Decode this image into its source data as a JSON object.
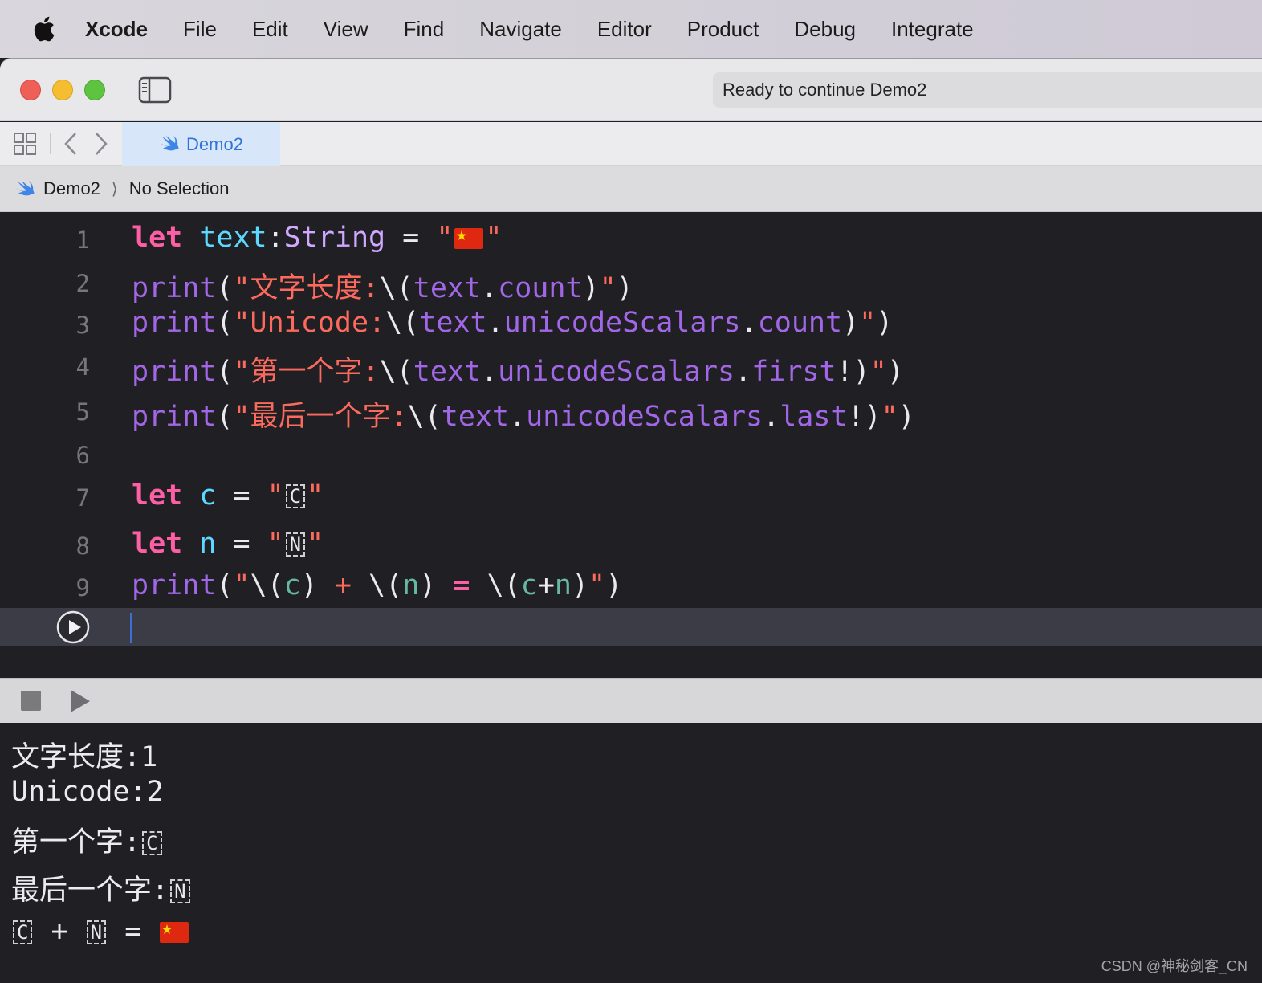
{
  "menubar": {
    "app_name": "Xcode",
    "items": [
      "File",
      "Edit",
      "View",
      "Find",
      "Navigate",
      "Editor",
      "Product",
      "Debug",
      "Integrate"
    ]
  },
  "toolbar": {
    "status_text": "Ready to continue Demo2"
  },
  "tabs": [
    {
      "label": "Demo2",
      "icon": "swift-icon",
      "active": true
    }
  ],
  "jumpbar": {
    "project": "Demo2",
    "selection": "No Selection"
  },
  "editor": {
    "line_numbers": [
      "1",
      "2",
      "3",
      "4",
      "5",
      "6",
      "7",
      "8",
      "9"
    ],
    "lines": {
      "l1": {
        "kw": "let",
        "name": "text",
        "colon": ":",
        "type": "String",
        "eq": " = ",
        "q1": "\"",
        "q2": "\""
      },
      "l2": {
        "fn": "print",
        "p1": "(",
        "str": "\"文字长度:",
        "interp": "\\(",
        "a": "text",
        "dot": ".",
        "b": "count",
        "close": ")",
        "q": "\"",
        "p2": ")"
      },
      "l3": {
        "fn": "print",
        "p1": "(",
        "str": "\"Unicode:",
        "interp": "\\(",
        "a": "text",
        "dot1": ".",
        "b": "unicodeScalars",
        "dot2": ".",
        "c": "count",
        "close": ")",
        "q": "\"",
        "p2": ")"
      },
      "l4": {
        "fn": "print",
        "p1": "(",
        "str": "\"第一个字:",
        "interp": "\\(",
        "a": "text",
        "dot1": ".",
        "b": "unicodeScalars",
        "dot2": ".",
        "c": "first",
        "bang": "!",
        "close": ")",
        "q": "\"",
        "p2": ")"
      },
      "l5": {
        "fn": "print",
        "p1": "(",
        "str": "\"最后一个字:",
        "interp": "\\(",
        "a": "text",
        "dot1": ".",
        "b": "unicodeScalars",
        "dot2": ".",
        "c": "last",
        "bang": "!",
        "close": ")",
        "q": "\"",
        "p2": ")"
      },
      "l7": {
        "kw": "let",
        "name": "c",
        "eq": " = ",
        "q1": "\"",
        "box": "C",
        "q2": "\""
      },
      "l8": {
        "kw": "let",
        "name": "n",
        "eq": " = ",
        "q1": "\"",
        "box": "N",
        "q2": "\""
      },
      "l9": {
        "fn": "print",
        "p1": "(",
        "q1": "\"",
        "i1": "\\(",
        "a": "c",
        "c1": ")",
        "plus": " + ",
        "i2": "\\(",
        "b": "n",
        "c2": ")",
        "eq": " = ",
        "i3": "\\(",
        "x": "c",
        "op": "+",
        "y": "n",
        "c3": ")",
        "q2": "\"",
        "p2": ")"
      }
    }
  },
  "console": {
    "lines": [
      "文字长度:1",
      "Unicode:2"
    ],
    "line3_prefix": "第一个字:",
    "line3_box": "C",
    "line4_prefix": "最后一个字:",
    "line4_box": "N",
    "line5": {
      "box1": "C",
      "plus": " + ",
      "box2": "N",
      "eq": " = "
    }
  },
  "watermark": "CSDN @神秘剑客_CN",
  "colors": {
    "keyword": "#fc5fa3",
    "string": "#fc6a5d",
    "function": "#a167e6",
    "variable": "#5dd8ff",
    "accent": "#2f73d8"
  }
}
